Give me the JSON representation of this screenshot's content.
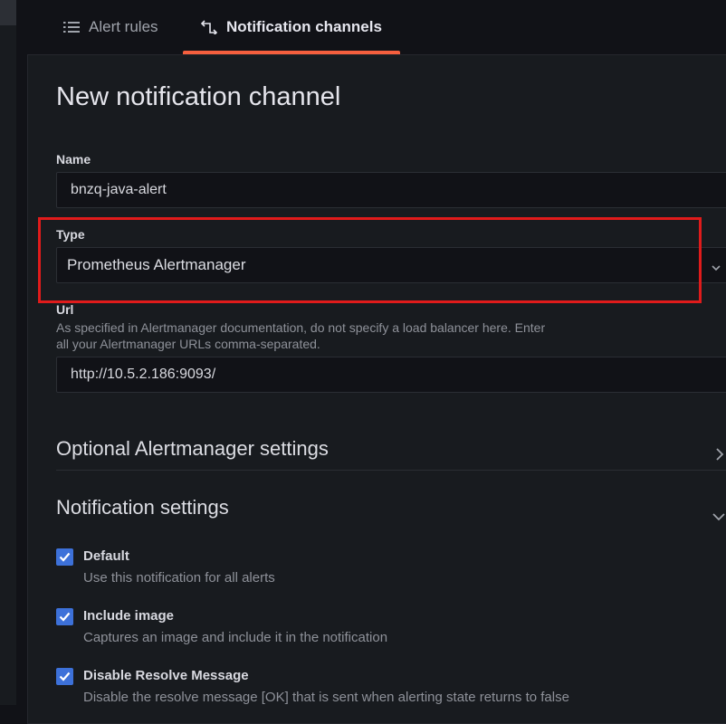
{
  "tabs": [
    {
      "label": "Alert rules",
      "active": false
    },
    {
      "label": "Notification channels",
      "active": true
    }
  ],
  "page_title": "New notification channel",
  "form": {
    "name": {
      "label": "Name",
      "value": "bnzq-java-alert"
    },
    "type": {
      "label": "Type",
      "value": "Prometheus Alertmanager"
    },
    "url": {
      "label": "Url",
      "description_line1": "As specified in Alertmanager documentation, do not specify a load balancer here. Enter",
      "description_line2": "all your Alertmanager URLs comma-separated.",
      "value": "http://10.5.2.186:9093/"
    }
  },
  "sections": {
    "optional": {
      "label": "Optional Alertmanager settings",
      "expanded": false
    },
    "notification": {
      "label": "Notification settings",
      "expanded": true
    }
  },
  "notification_settings": [
    {
      "label": "Default",
      "description": "Use this notification for all alerts",
      "checked": true
    },
    {
      "label": "Include image",
      "description": "Captures an image and include it in the notification",
      "checked": true
    },
    {
      "label": "Disable Resolve Message",
      "description": "Disable the resolve message [OK] that is sent when alerting state returns to false",
      "checked": true
    }
  ],
  "colors": {
    "accent_tab": "#f55f3e",
    "checkbox": "#3d71d9",
    "highlight": "#e01b1b"
  }
}
